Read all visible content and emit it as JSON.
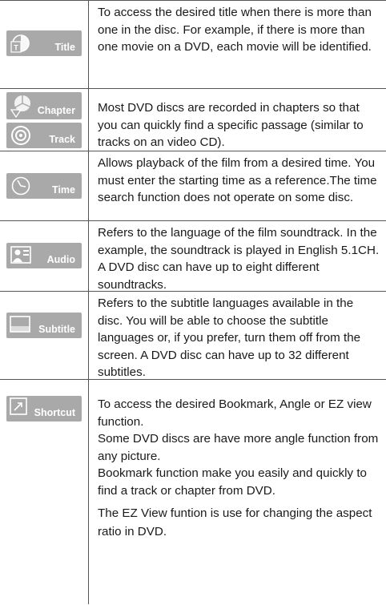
{
  "rows": [
    {
      "labels": [
        "Title"
      ],
      "icon": "disc-title-icon",
      "text": [
        "To access the desired title when there is more than one in the disc. For example, if there is more than one movie on a DVD, each movie will be identified."
      ]
    },
    {
      "labels": [
        "Chapter",
        "Track"
      ],
      "icon": "disc-chapter-icon",
      "text": [
        "Most DVD discs are recorded in chapters so that you can quickly find a specific passage (similar to tracks on an video CD)."
      ]
    },
    {
      "labels": [
        "Time"
      ],
      "icon": "clock-icon",
      "text": [
        "Allows playback of the film from a desired time. You must enter the starting time as a reference.The time search function does not operate on some disc."
      ]
    },
    {
      "labels": [
        "Audio"
      ],
      "icon": "audio-icon",
      "text": [
        "Refers to the language of the film soundtrack. In the example, the soundtrack is played in English 5.1CH. A DVD disc can have up to eight different soundtracks."
      ]
    },
    {
      "labels": [
        "Subtitle"
      ],
      "icon": "subtitle-icon",
      "text": [
        "Refers to the subtitle languages available in the disc. You will be able to choose the subtitle languages or, if you prefer, turn them off from the screen. A DVD disc can have up to 32 different subtitles."
      ]
    },
    {
      "labels": [
        "Shortcut"
      ],
      "icon": "shortcut-icon",
      "text": [
        "To access the desired Bookmark, Angle or EZ view function.",
        "Some DVD discs are have more angle function from any picture.",
        "Bookmark function make you easily and quickly to find a track or chapter from DVD.",
        "The EZ View funtion is use for changing the aspect ratio in DVD."
      ]
    }
  ],
  "colors": {
    "badge": "#a9a9a9",
    "rule": "#555555",
    "text": "#1a1a1a"
  }
}
